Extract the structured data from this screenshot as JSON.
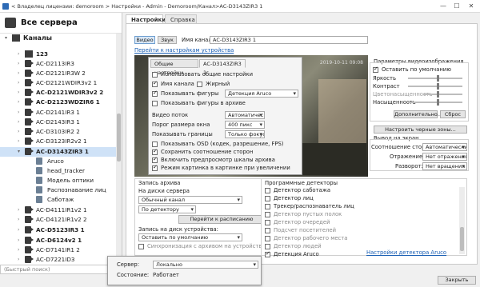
{
  "window": {
    "title": "< Владелец лицензии: demoroom > Настройки - Admin - Demoroom/Канал>AC-D3143ZIR3 1",
    "minimize": "—",
    "maximize": "☐",
    "close": "✕"
  },
  "tree": {
    "header": "Все сервера",
    "items": [
      {
        "label": "Каналы",
        "bold": true
      },
      {
        "label": "123",
        "bold": true
      },
      {
        "label": "AC-D2113IR3",
        "bold": false
      },
      {
        "label": "AC-D2121IR3W 2",
        "bold": false
      },
      {
        "label": "AC-D2121WDIR3v2 1",
        "bold": false
      },
      {
        "label": "AC-D2121WDIR3v2 2",
        "bold": true
      },
      {
        "label": "AC-D2123WDZIR6 1",
        "bold": true
      },
      {
        "label": "AC-D2141IR3 1",
        "bold": false
      },
      {
        "label": "AC-D2143IR3 1",
        "bold": false
      },
      {
        "label": "AC-D3103IR2 2",
        "bold": false
      },
      {
        "label": "AC-D3123IR2v2 1",
        "bold": false
      },
      {
        "label": "AC-D3143ZIR3 1",
        "bold": true
      },
      {
        "label": "Aruco",
        "bold": false
      },
      {
        "label": "head_tracker",
        "bold": false
      },
      {
        "label": "Модель оптики",
        "bold": false
      },
      {
        "label": "Распознавание лиц",
        "bold": false
      },
      {
        "label": "Саботаж",
        "bold": false
      },
      {
        "label": "AC-D4111IR1v2 1",
        "bold": false
      },
      {
        "label": "AC-D4121IR1v2 2",
        "bold": false
      },
      {
        "label": "AC-D5123IR3 1",
        "bold": true
      },
      {
        "label": "AC-D6124v2 1",
        "bold": true
      },
      {
        "label": "AC-D7141IR1 2",
        "bold": false
      },
      {
        "label": "AC-D7221ID3",
        "bold": false
      }
    ]
  },
  "quick_search": {
    "placeholder": "(Быстрый поиск)"
  },
  "tabs": [
    {
      "label": "Настройки"
    },
    {
      "label": "Справка"
    }
  ],
  "main": {
    "video_btn": "Видео",
    "sound_btn": "Звук",
    "channel_name_label": "Имя канала:",
    "channel_name_value": "AC-D3143ZIR3 1",
    "device_settings_link": "Перейти к настройкам устройства"
  },
  "video": {
    "timestamp": "2019-10-11 09:08"
  },
  "overlay": {
    "tab_general": "Общие настройки",
    "tab_channel": "AC-D3143ZIR3 1",
    "use_defaults": "Использовать общие настройки",
    "show_name": "Имя канала",
    "bold": "Жирный",
    "show_shapes": "Показывать фигуры",
    "shapes_value": "Детекция Aruco",
    "show_shapes_archive": "Показывать фигуры в архиве",
    "video_stream_label": "Видео поток",
    "video_stream_value": "Автоматически",
    "window_threshold_label": "Порог размера окна",
    "window_threshold_value": "400 пикс",
    "show_borders_label": "Показывать границы",
    "show_borders_value": "Только фокус",
    "show_osd": "Показывать OSD (кодек, разрешение, FPS)",
    "keep_aspect": "Сохранить соотношение сторон",
    "enable_preview": "Включить предпросмотр шкалы архива",
    "pip_mode": "Режим картинка в картинке при увеличении"
  },
  "image_params": {
    "title": "Параметры видеоизображения",
    "default": "Оставить по умолчанию",
    "brightness": "Яркость",
    "contrast": "Контраст",
    "saturation": "Цветонасыщенность",
    "sharpness": "Насыщенность",
    "more_btn": "Дополнительно...",
    "reset_btn": "Сброс",
    "black_zones_btn": "Настроить черные зоны..."
  },
  "output": {
    "title": "Вывод на экран",
    "aspect_label": "Соотношение сторон:",
    "aspect_value": "Автоматически",
    "flip_label": "Отражение:",
    "flip_value": "Нет отражения",
    "rotate_label": "Разворот:",
    "rotate_value": "Нет вращения"
  },
  "archive": {
    "title": "Запись архива",
    "server_disk_label": "На диски сервера",
    "mode_value": "Обычный канал",
    "detector_value": "По детектору",
    "schedule_btn": "Перейти к расписанию",
    "device_disk_label": "Запись на диск устройства:",
    "device_disk_value": "Оставить по умолчанию",
    "sync_archive": "Синхронизация с архивом на устройстве"
  },
  "detectors": {
    "title": "Программные детекторы",
    "items": [
      {
        "label": "Детектор саботажа",
        "checked": false
      },
      {
        "label": "Детектор лиц",
        "checked": false
      },
      {
        "label": "Трекер/распознаватель лиц",
        "checked": false
      },
      {
        "label": "Детектор пустых полок",
        "checked": false
      },
      {
        "label": "Детектор очередей",
        "checked": false
      },
      {
        "label": "Подсчет посетителей",
        "checked": false
      },
      {
        "label": "Детектор рабочего места",
        "checked": false
      },
      {
        "label": "Детектор людей",
        "checked": false
      },
      {
        "label": "Детекция Aruco",
        "checked": true
      }
    ],
    "aruco_settings_link": "Настройки детектора Aruco"
  },
  "popup": {
    "server_label": "Сервер:",
    "server_value": "Локально",
    "state_label": "Состояние:",
    "state_value": "Работает"
  },
  "close_btn": "Закрыть"
}
